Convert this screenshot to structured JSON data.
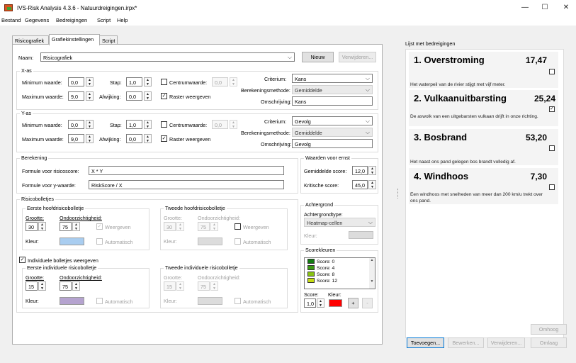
{
  "window": {
    "title": "IVS-Risk Analysis 4.3.6 - Natuurdreigingen.irpx*",
    "minimize": "—",
    "maximize": "☐",
    "close": "✕"
  },
  "menu": [
    "Bestand",
    "Gegevens",
    "Bedreigingen",
    "Script",
    "Help"
  ],
  "tabs": [
    "Risicografiek",
    "Grafiekinstellingen",
    "Script"
  ],
  "naam": {
    "label": "Naam:",
    "value": "Risicografiek",
    "new_label": "Nieuw",
    "delete_label": "Verwijderen..."
  },
  "xas": {
    "title": "X-as",
    "min_label": "Minimum waarde:",
    "min": "0,0",
    "max_label": "Maximum waarde:",
    "max": "9,0",
    "step_label": "Stap:",
    "step": "1,0",
    "dev_label": "Afwijking:",
    "dev": "0,0",
    "center_label": "Centrumwaarde:",
    "center": "0,0",
    "grid_label": "Raster weergeven",
    "criterium_label": "Criterium:",
    "criterium": "Kans",
    "method_label": "Berekeningsmethode:",
    "method": "Gemiddelde",
    "desc_label": "Omschrijving:",
    "desc": "Kans"
  },
  "yas": {
    "title": "Y-as",
    "min_label": "Minimum waarde:",
    "min": "0,0",
    "max_label": "Maximum waarde:",
    "max": "9,0",
    "step_label": "Stap:",
    "step": "1,0",
    "dev_label": "Afwijking:",
    "dev": "0,0",
    "center_label": "Centrumwaarde:",
    "center": "0,0",
    "grid_label": "Raster weergeven",
    "criterium_label": "Criterium:",
    "criterium": "Gevolg",
    "method_label": "Berekeningsmethode:",
    "method": "Gemiddelde",
    "desc_label": "Omschrijving:",
    "desc": "Gevolg"
  },
  "berekening": {
    "title": "Berekening",
    "risk_label": "Formule voor risicoscore:",
    "risk": "X * Y",
    "y_label": "Formule voor y-waarde:",
    "y": "RiskScore / X"
  },
  "ernst": {
    "title": "Waarden voor ernst",
    "avg_label": "Gemiddelde score:",
    "avg": "12,0",
    "crit_label": "Kritische score:",
    "crit": "45,0"
  },
  "bolletjes": {
    "title": "Risicobolletjes",
    "size_label": "Grootte:",
    "opacity_label": "Ondoorzichtigheid:",
    "color_label": "Kleur:",
    "show_label": "Weergeven",
    "auto_label": "Automatisch",
    "main1": {
      "title": "Eerste hoofdrisicobolletje",
      "size": "30",
      "opacity": "75",
      "color": "#a9cdf0"
    },
    "main2": {
      "title": "Tweede hoofdrisicobolletje",
      "size": "30",
      "opacity": "75"
    },
    "individual_label": "Individuele bolletjes weergeven",
    "ind1": {
      "title": "Eerste individuele risicobolletje",
      "size": "15",
      "opacity": "75",
      "color": "#b5a3cf"
    },
    "ind2": {
      "title": "Tweede individuele risicobolletje",
      "size": "15",
      "opacity": "75"
    }
  },
  "achtergrond": {
    "title": "Achtergrond",
    "type_label": "Achtergrondtype:",
    "type": "Heatmap-cellen",
    "color_label": "Kleur:"
  },
  "scorekleuren": {
    "title": "Scorekleuren",
    "items": [
      {
        "label": "Score: 0",
        "color": "#127a12"
      },
      {
        "label": "Score: 4",
        "color": "#3a9a12"
      },
      {
        "label": "Score: 8",
        "color": "#88c212"
      },
      {
        "label": "Score: 12",
        "color": "#c6dc12"
      }
    ],
    "score_label": "Score:",
    "score": "1,0",
    "color_label": "Kleur:",
    "color": "#ff0000",
    "add": "+",
    "remove": "-"
  },
  "risklist": {
    "title": "Lijst met bedreigingen",
    "items": [
      {
        "name": "1. Overstroming",
        "score": "17,47",
        "desc": "Het waterpeil van de rivier stijgt met vijf meter.",
        "checked": ""
      },
      {
        "name": "2. Vulkaanuitbarsting",
        "score": "25,24",
        "desc": "De aswolk van een uitgebarsten vulkaan drijft in onze richting.",
        "checked": "✓"
      },
      {
        "name": "3. Bosbrand",
        "score": "53,20",
        "desc": "Het naast ons pand gelegen bos brandt volledig af.",
        "checked": ""
      },
      {
        "name": "4. Windhoos",
        "score": "7,30",
        "desc": "Een windhoos met snelheden van meer dan 200 km/u trekt over ons pand.",
        "checked": ""
      }
    ],
    "up": "Omhoog",
    "down": "Omlaag",
    "add": "Toevoegen...",
    "edit": "Bewerken...",
    "delete": "Verwijderen..."
  }
}
